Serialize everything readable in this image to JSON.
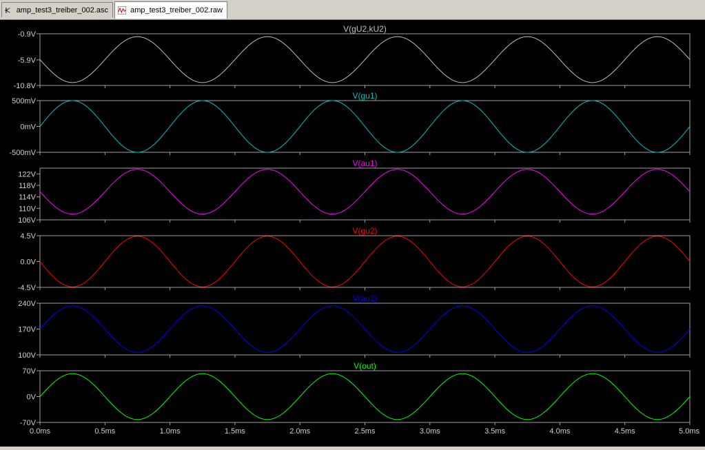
{
  "tabs": [
    {
      "label": "amp_test3_treiber_002.asc",
      "icon": "schematic-icon",
      "active": false
    },
    {
      "label": "amp_test3_treiber_002.raw",
      "icon": "waveform-icon",
      "active": true
    }
  ],
  "chart_data": {
    "type": "line",
    "xlabel": "",
    "x_ticks": [
      "0.0ms",
      "0.5ms",
      "1.0ms",
      "1.5ms",
      "2.0ms",
      "2.5ms",
      "3.0ms",
      "3.5ms",
      "4.0ms",
      "4.5ms",
      "5.0ms"
    ],
    "xlim": [
      0,
      5
    ],
    "x_unit": "ms",
    "grid": false,
    "panes": [
      {
        "name": "V(gU2,kU2)",
        "color": "#c0c0c0",
        "ylim": [
          -10.8,
          -0.9
        ],
        "y_ticks": [
          {
            "v": -0.9,
            "label": "-0.9V"
          },
          {
            "v": -5.9,
            "label": "-5.9V"
          },
          {
            "v": -10.8,
            "label": "-10.8V"
          }
        ],
        "offset": -5.85,
        "amplitude": 4.4,
        "frequency_khz": 1,
        "phase_deg": 180
      },
      {
        "name": "V(gu1)",
        "color": "#00c0c0",
        "ylim": [
          -500,
          500
        ],
        "y_ticks": [
          {
            "v": 500,
            "label": "500mV"
          },
          {
            "v": 0,
            "label": "0mV"
          },
          {
            "v": -500,
            "label": "-500mV"
          }
        ],
        "offset": 0,
        "amplitude": 500,
        "frequency_khz": 1,
        "phase_deg": 0
      },
      {
        "name": "V(au1)",
        "color": "#ff00ff",
        "ylim": [
          106,
          124
        ],
        "y_ticks": [
          {
            "v": 122,
            "label": "122V"
          },
          {
            "v": 118,
            "label": "118V"
          },
          {
            "v": 114,
            "label": "114V"
          },
          {
            "v": 110,
            "label": "110V"
          },
          {
            "v": 106,
            "label": "106V"
          }
        ],
        "offset": 115.8,
        "amplitude": 7.8,
        "frequency_khz": 1,
        "phase_deg": 180
      },
      {
        "name": "V(gu2)",
        "color": "#ff0000",
        "ylim": [
          -4.5,
          4.5
        ],
        "y_ticks": [
          {
            "v": 4.5,
            "label": "4.5V"
          },
          {
            "v": 0,
            "label": "0.0V"
          },
          {
            "v": -4.5,
            "label": "-4.5V"
          }
        ],
        "offset": 0,
        "amplitude": 4.4,
        "frequency_khz": 1,
        "phase_deg": 180
      },
      {
        "name": "V(au2)",
        "color": "#0000ff",
        "ylim": [
          100,
          240
        ],
        "y_ticks": [
          {
            "v": 240,
            "label": "240V"
          },
          {
            "v": 170,
            "label": "170V"
          },
          {
            "v": 100,
            "label": "100V"
          }
        ],
        "offset": 170,
        "amplitude": 63,
        "frequency_khz": 1,
        "phase_deg": 0
      },
      {
        "name": "V(out)",
        "color": "#00ff00",
        "ylim": [
          -70,
          70
        ],
        "y_ticks": [
          {
            "v": 70,
            "label": "70V"
          },
          {
            "v": 0,
            "label": "0V"
          },
          {
            "v": -70,
            "label": "-70V"
          }
        ],
        "offset": 0,
        "amplitude": 62,
        "frequency_khz": 1,
        "phase_deg": 0
      }
    ]
  }
}
